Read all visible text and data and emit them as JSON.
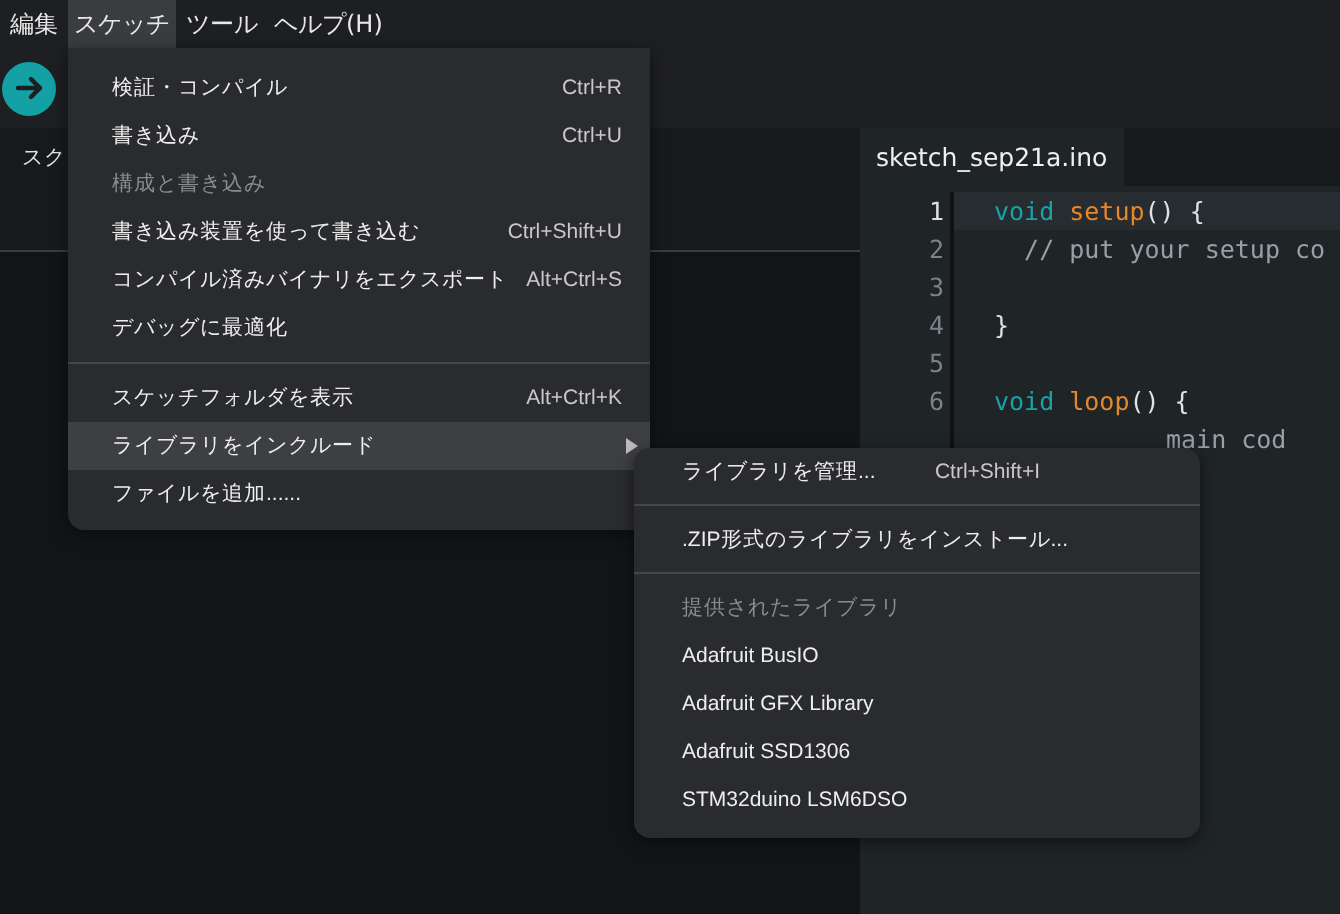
{
  "menubar": [
    {
      "label": "編集",
      "selected": false
    },
    {
      "label": "スケッチ",
      "selected": true
    },
    {
      "label": "ツール",
      "selected": false
    },
    {
      "label": "ヘルプ(H)",
      "selected": false
    }
  ],
  "sidebar": {
    "title": "スク"
  },
  "editor": {
    "tabs": [
      {
        "label": "sketch_sep21a.ino",
        "selected": true
      }
    ],
    "lines": [
      {
        "number": "1",
        "active": true,
        "tokens": [
          {
            "kind": "keyword",
            "text": "void"
          },
          {
            "kind": "function",
            "text": "setup"
          },
          {
            "kind": "plain",
            "text": "() {"
          }
        ]
      },
      {
        "number": "2",
        "active": false,
        "tokens": [
          {
            "kind": "comment",
            "text": "  // put your setup co"
          }
        ]
      },
      {
        "number": "3",
        "active": false
      },
      {
        "number": "4",
        "active": false,
        "tokens": [
          {
            "kind": "plain",
            "text": "}"
          }
        ]
      },
      {
        "number": "5",
        "active": false
      },
      {
        "number": "6",
        "active": false,
        "tokens": [
          {
            "kind": "keyword",
            "text": "void"
          },
          {
            "kind": "function",
            "text": "loop"
          },
          {
            "kind": "plain",
            "text": "() {"
          }
        ]
      },
      {
        "active": false,
        "partly_hidden": true,
        "tokens": [
          {
            "kind": "comment",
            "text": "main cod"
          }
        ]
      }
    ]
  },
  "menu": {
    "items": [
      {
        "kind": "item",
        "label": "検証・コンパイル",
        "shortcut": "Ctrl+R",
        "disabled": false,
        "selected": false
      },
      {
        "kind": "item",
        "label": "書き込み",
        "shortcut": "Ctrl+U",
        "disabled": false,
        "selected": false
      },
      {
        "kind": "item",
        "label": "構成と書き込み",
        "disabled": true,
        "selected": false
      },
      {
        "kind": "item",
        "label": "書き込み装置を使って書き込む",
        "shortcut": "Ctrl+Shift+U",
        "disabled": false,
        "selected": false
      },
      {
        "kind": "item",
        "label": "コンパイル済みバイナリをエクスポート",
        "shortcut": "Alt+Ctrl+S",
        "disabled": false,
        "selected": false
      },
      {
        "kind": "item",
        "label": "デバッグに最適化",
        "disabled": false,
        "selected": false
      },
      {
        "kind": "separator"
      },
      {
        "kind": "item",
        "label": "スケッチフォルダを表示",
        "shortcut": "Alt+Ctrl+K",
        "disabled": false,
        "selected": false
      },
      {
        "kind": "submenu",
        "label": "ライブラリをインクルード",
        "disabled": false,
        "selected": true
      },
      {
        "kind": "item",
        "label": "ファイルを追加......",
        "disabled": false,
        "selected": false
      }
    ]
  },
  "submenu": {
    "items": [
      {
        "kind": "item",
        "label": "ライブラリを管理...",
        "shortcut": "Ctrl+Shift+I"
      },
      {
        "kind": "separator"
      },
      {
        "kind": "item",
        "label": ".ZIP形式のライブラリをインストール..."
      },
      {
        "kind": "separator"
      },
      {
        "kind": "heading",
        "label": "提供されたライブラリ"
      },
      {
        "kind": "item",
        "label": "Adafruit BusIO"
      },
      {
        "kind": "item",
        "label": "Adafruit GFX Library"
      },
      {
        "kind": "item",
        "label": "Adafruit SSD1306"
      },
      {
        "kind": "item",
        "label": "STM32duino LSM6DSO"
      }
    ]
  }
}
